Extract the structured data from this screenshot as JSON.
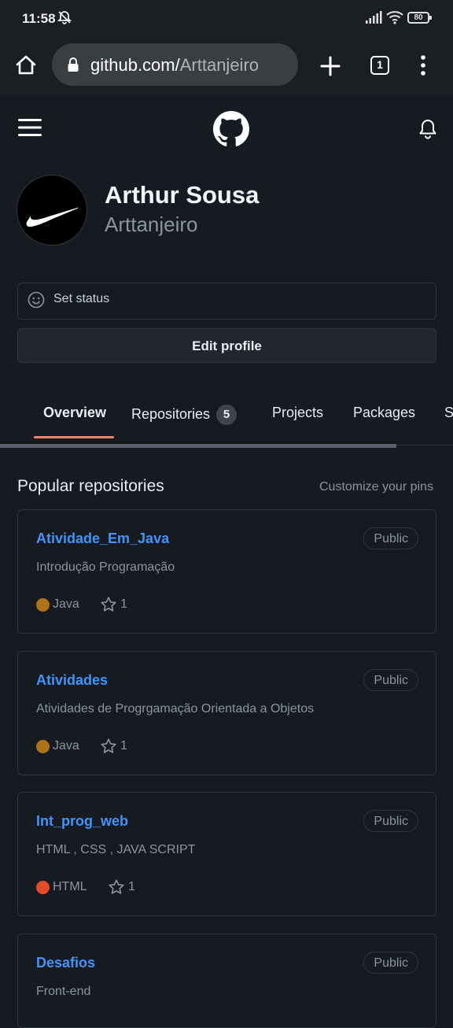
{
  "status_bar": {
    "time": "11:58",
    "battery": "80"
  },
  "browser": {
    "url_host": "github.com/",
    "url_path": "Arttanjeiro",
    "tab_count": "1"
  },
  "profile": {
    "full_name": "Arthur Sousa",
    "username": "Arttanjeiro"
  },
  "status": {
    "label": "Set status"
  },
  "edit_profile_label": "Edit profile",
  "tabs": [
    {
      "label": "Overview"
    },
    {
      "label": "Repositories",
      "count": "5"
    },
    {
      "label": "Projects"
    },
    {
      "label": "Packages"
    },
    {
      "label": "S"
    }
  ],
  "popular": {
    "title": "Popular repositories",
    "customize_label": "Customize your pins"
  },
  "repos": [
    {
      "name": "Atividade_Em_Java",
      "visibility": "Public",
      "description": "Introdução Programação",
      "language": "Java",
      "lang_color": "#b07219",
      "stars": "1"
    },
    {
      "name": "Atividades",
      "visibility": "Public",
      "description": "Atividades de Progrgamação Orientada a Objetos",
      "language": "Java",
      "lang_color": "#b07219",
      "stars": "1"
    },
    {
      "name": "Int_prog_web",
      "visibility": "Public",
      "description": "HTML , CSS , JAVA SCRIPT",
      "language": "HTML",
      "lang_color": "#e34c26",
      "stars": "1"
    },
    {
      "name": "Desafios",
      "visibility": "Public",
      "description": "Front-end"
    }
  ]
}
